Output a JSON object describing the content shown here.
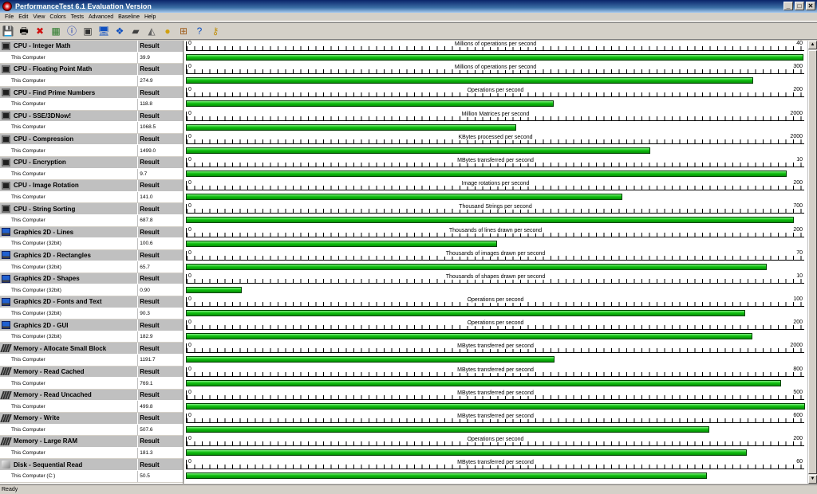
{
  "window": {
    "title": "PerformanceTest 6.1 Evaluation Version",
    "min_label": "_",
    "max_label": "□",
    "close_label": "✕"
  },
  "menu": [
    "File",
    "Edit",
    "View",
    "Colors",
    "Tests",
    "Advanced",
    "Baseline",
    "Help"
  ],
  "toolbar": [
    {
      "icon": "save-icon",
      "glyph": "💾"
    },
    {
      "icon": "print-icon",
      "glyph": "🖶"
    },
    {
      "icon": "delete-icon",
      "glyph": "✖",
      "color": "#d01010"
    },
    {
      "icon": "export-icon",
      "glyph": "▦",
      "color": "#2a7a2a"
    },
    {
      "icon": "info-icon",
      "glyph": "ⓘ",
      "color": "#1030b0"
    },
    {
      "icon": "cpu-test-icon",
      "glyph": "▣",
      "color": "#303030"
    },
    {
      "icon": "2d-graphics-icon",
      "glyph": "🖥",
      "color": "#1050c0"
    },
    {
      "icon": "3d-graphics-icon",
      "glyph": "❖",
      "color": "#1050c0"
    },
    {
      "icon": "memory-test-icon",
      "glyph": "▰",
      "color": "#404040"
    },
    {
      "icon": "disk-test-icon",
      "glyph": "◭",
      "color": "#606060"
    },
    {
      "icon": "cd-test-icon",
      "glyph": "●",
      "color": "#d0a010"
    },
    {
      "icon": "network-test-icon",
      "glyph": "⊞",
      "color": "#a06020"
    },
    {
      "icon": "help-icon",
      "glyph": "?",
      "color": "#1050c0"
    },
    {
      "icon": "key-icon",
      "glyph": "⚷",
      "color": "#c09010"
    }
  ],
  "result_header": "Result",
  "tests": [
    {
      "name": "CPU - Integer Math",
      "icon": "cpu-icon",
      "computer": "This Computer",
      "value": "39.9",
      "unit": "Millions of operations per second",
      "max": "40",
      "fraction": 0.9975
    },
    {
      "name": "CPU - Floating Point Math",
      "icon": "cpu-icon",
      "computer": "This Computer",
      "value": "274.9",
      "unit": "Millions of operations per second",
      "max": "300",
      "fraction": 0.916
    },
    {
      "name": "CPU - Find Prime Numbers",
      "icon": "cpu-icon",
      "computer": "This Computer",
      "value": "118.8",
      "unit": "Operations per second",
      "max": "200",
      "fraction": 0.594
    },
    {
      "name": "CPU - SSE/3DNow!",
      "icon": "cpu-icon",
      "computer": "This Computer",
      "value": "1068.5",
      "unit": "Million Matrices per second",
      "max": "2000",
      "fraction": 0.534
    },
    {
      "name": "CPU - Compression",
      "icon": "cpu-icon",
      "computer": "This Computer",
      "value": "1499.0",
      "unit": "KBytes processed per second",
      "max": "2000",
      "fraction": 0.7495
    },
    {
      "name": "CPU - Encryption",
      "icon": "cpu-icon",
      "computer": "This Computer",
      "value": "9.7",
      "unit": "MBytes transferred per second",
      "max": "10",
      "fraction": 0.97
    },
    {
      "name": "CPU - Image Rotation",
      "icon": "cpu-icon",
      "computer": "This Computer",
      "value": "141.0",
      "unit": "Image rotations per second",
      "max": "200",
      "fraction": 0.705
    },
    {
      "name": "CPU - String Sorting",
      "icon": "cpu-icon",
      "computer": "This Computer",
      "value": "687.8",
      "unit": "Thousand Strings per second",
      "max": "700",
      "fraction": 0.9826
    },
    {
      "name": "Graphics 2D - Lines",
      "icon": "monitor-icon",
      "computer": "This Computer (32bit)",
      "value": "100.6",
      "unit": "Thousands of lines drawn per second",
      "max": "200",
      "fraction": 0.503
    },
    {
      "name": "Graphics 2D - Rectangles",
      "icon": "monitor-icon",
      "computer": "This Computer (32bit)",
      "value": "65.7",
      "unit": "Thousands of images drawn per second",
      "max": "70",
      "fraction": 0.9386
    },
    {
      "name": "Graphics 2D - Shapes",
      "icon": "monitor-icon",
      "computer": "This Computer (32bit)",
      "value": "0.90",
      "unit": "Thousands of shapes drawn per second",
      "max": "10",
      "fraction": 0.09
    },
    {
      "name": "Graphics 2D - Fonts and Text",
      "icon": "monitor-icon",
      "computer": "This Computer (32bit)",
      "value": "90.3",
      "unit": "Operations per second",
      "max": "100",
      "fraction": 0.903
    },
    {
      "name": "Graphics 2D - GUI",
      "icon": "monitor-icon",
      "computer": "This Computer (32bit)",
      "value": "182.9",
      "unit": "Operations per second",
      "max": "200",
      "fraction": 0.9145
    },
    {
      "name": "Memory - Allocate Small Block",
      "icon": "memory-icon",
      "computer": "This Computer",
      "value": "1191.7",
      "unit": "MBytes transferred per second",
      "max": "2000",
      "fraction": 0.596
    },
    {
      "name": "Memory - Read Cached",
      "icon": "memory-icon",
      "computer": "This Computer",
      "value": "769.1",
      "unit": "MBytes transferred per second",
      "max": "800",
      "fraction": 0.961
    },
    {
      "name": "Memory - Read Uncached",
      "icon": "memory-icon",
      "computer": "This Computer",
      "value": "499.8",
      "unit": "MBytes transferred per second",
      "max": "500",
      "fraction": 0.9996
    },
    {
      "name": "Memory - Write",
      "icon": "memory-icon",
      "computer": "This Computer",
      "value": "507.6",
      "unit": "MBytes transferred per second",
      "max": "600",
      "fraction": 0.846
    },
    {
      "name": "Memory - Large RAM",
      "icon": "memory-icon",
      "computer": "This Computer",
      "value": "181.3",
      "unit": "Operations per second",
      "max": "200",
      "fraction": 0.9065
    },
    {
      "name": "Disk - Sequential Read",
      "icon": "disk-icon",
      "computer": "This Computer (C:)",
      "value": "50.5",
      "unit": "MBytes transferred per second",
      "max": "60",
      "fraction": 0.8417
    }
  ],
  "status": "Ready"
}
